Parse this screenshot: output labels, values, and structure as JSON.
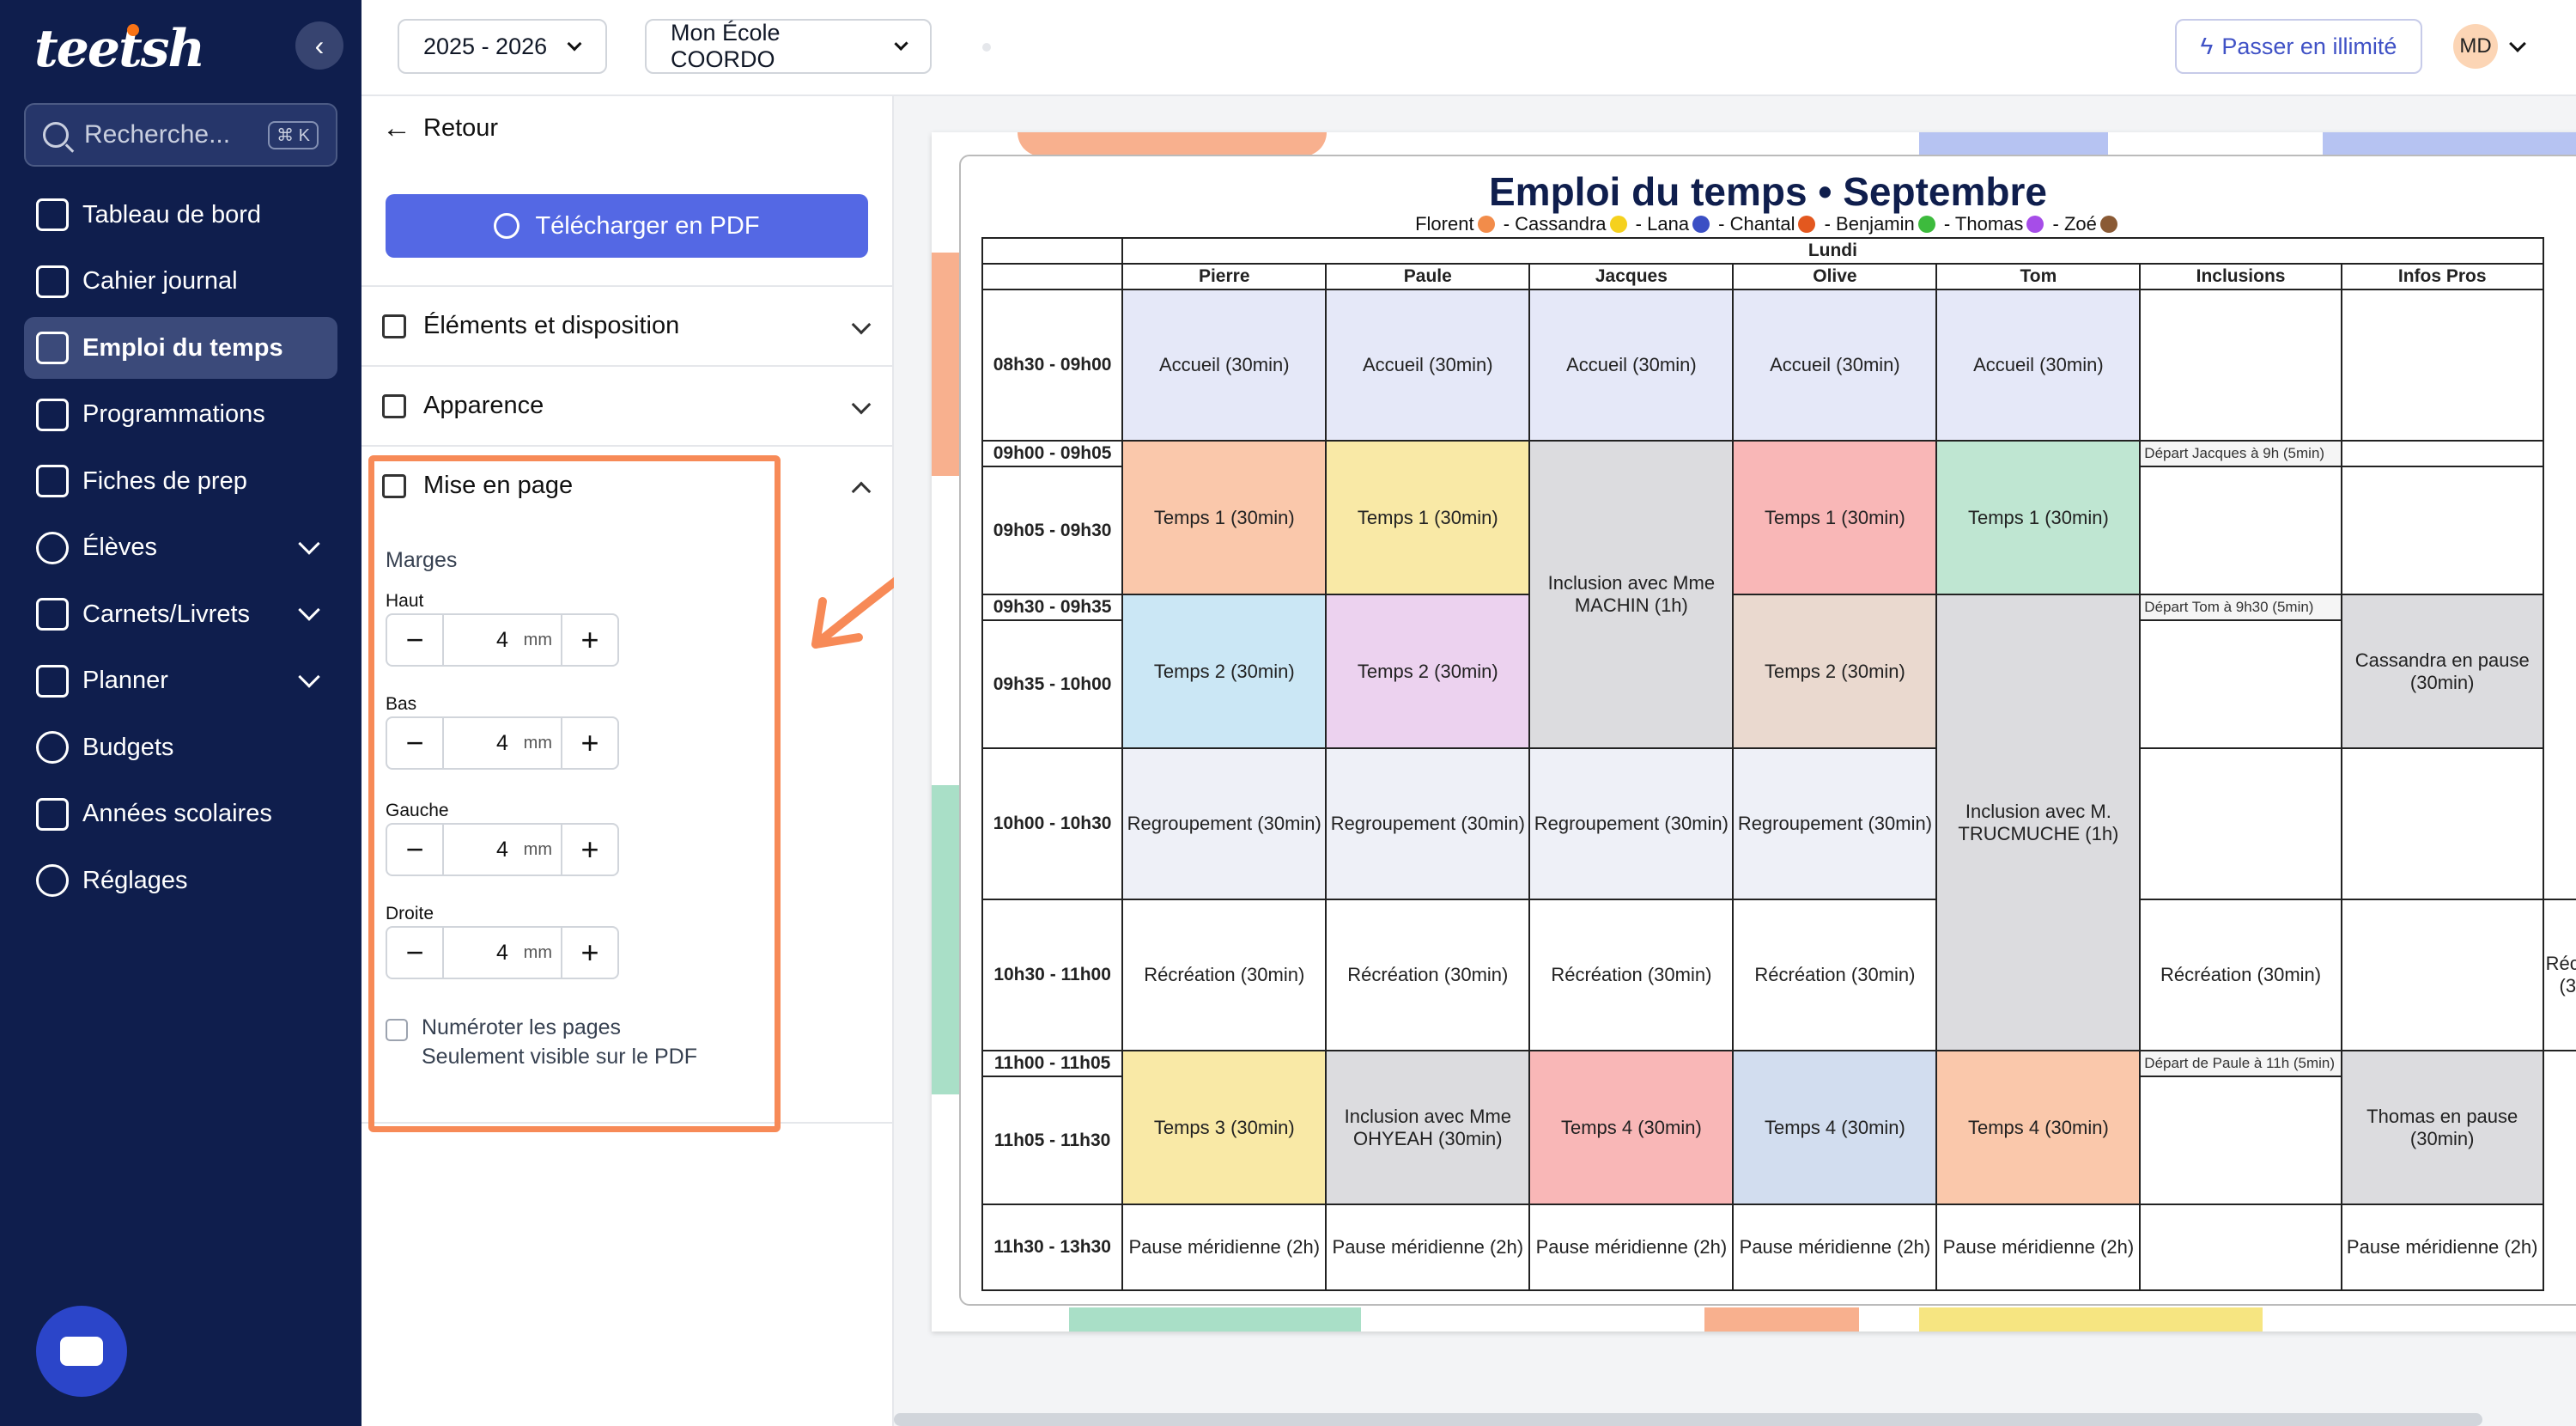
{
  "app": {
    "logo": "teetsh"
  },
  "sidebar": {
    "search_placeholder": "Recherche...",
    "search_shortcut": "⌘ K",
    "items": [
      {
        "label": "Tableau de bord",
        "icon": "dashboard-icon"
      },
      {
        "label": "Cahier journal",
        "icon": "book-icon"
      },
      {
        "label": "Emploi du temps",
        "icon": "calendar-icon",
        "active": true
      },
      {
        "label": "Programmations",
        "icon": "list-icon"
      },
      {
        "label": "Fiches de prep",
        "icon": "document-icon"
      },
      {
        "label": "Élèves",
        "icon": "students-icon",
        "expandable": true
      },
      {
        "label": "Carnets/Livrets",
        "icon": "notebook-icon",
        "expandable": true
      },
      {
        "label": "Planner",
        "icon": "planner-icon",
        "expandable": true
      },
      {
        "label": "Budgets",
        "icon": "piggy-bank-icon"
      },
      {
        "label": "Années scolaires",
        "icon": "school-icon"
      },
      {
        "label": "Réglages",
        "icon": "gear-icon"
      }
    ]
  },
  "topbar": {
    "year": "2025 - 2026",
    "school": "Mon École COORDO",
    "upgrade_label": "Passer en illimité",
    "avatar_initials": "MD"
  },
  "panel": {
    "back_label": "Retour",
    "pdf_button": "Télécharger en PDF",
    "sections": {
      "elements": "Éléments et disposition",
      "appearance": "Apparence",
      "layout": "Mise en page"
    },
    "margins_title": "Marges",
    "margins": [
      {
        "label": "Haut",
        "value": "4",
        "unit": "mm"
      },
      {
        "label": "Bas",
        "value": "4",
        "unit": "mm"
      },
      {
        "label": "Gauche",
        "value": "4",
        "unit": "mm"
      },
      {
        "label": "Droite",
        "value": "4",
        "unit": "mm"
      }
    ],
    "number_pages_label": "Numéroter les pages",
    "number_pages_sub": "Seulement visible sur le PDF"
  },
  "schedule": {
    "title": "Emploi du temps • Septembre",
    "students": [
      {
        "name": "Florent",
        "color": "#f28c4a"
      },
      {
        "name": "Cassandra",
        "color": "#f5d11e"
      },
      {
        "name": "Lana",
        "color": "#3b4fc4"
      },
      {
        "name": "Chantal",
        "color": "#e3581f"
      },
      {
        "name": "Benjamin",
        "color": "#3dbb3d"
      },
      {
        "name": "Thomas",
        "color": "#a64de8"
      },
      {
        "name": "Zoé",
        "color": "#8a5a35"
      }
    ],
    "day": "Lundi",
    "columns": [
      "Pierre",
      "Paule",
      "Jacques",
      "Olive",
      "Tom",
      "Inclusions",
      "Infos Pros"
    ],
    "times": {
      "t1": "08h30 - 09h00",
      "t2": "09h00 - 09h05",
      "t3": "09h05 - 09h30",
      "t4": "09h30 - 09h35",
      "t5": "09h35 - 10h00",
      "t6": "10h00 - 10h30",
      "t7": "10h30 - 11h00",
      "t8": "11h00 - 11h05",
      "t9": "11h05 - 11h30",
      "t10": "11h30 - 13h30"
    },
    "cells": {
      "accueil": "Accueil (30min)",
      "temps1": "Temps 1 (30min)",
      "temps2": "Temps 2 (30min)",
      "temps3": "Temps 3 (30min)",
      "temps4": "Temps 4 (30min)",
      "regroupement": "Regroupement (30min)",
      "recreation": "Récréation (30min)",
      "pause": "Pause méridienne (2h)",
      "inclusion_machin": "Inclusion avec Mme MACHIN (1h)",
      "inclusion_trucmuche": "Inclusion avec M. TRUCMUCHE (1h)",
      "inclusion_ohyeah": "Inclusion avec Mme OHYEAH (30min)",
      "depart_jacques": "Départ Jacques à 9h (5min)",
      "depart_tom": "Départ Tom à 9h30 (5min)",
      "depart_paule": "Départ de Paule à 11h (5min)",
      "cassandra_pause": "Cassandra en pause (30min)",
      "thomas_pause": "Thomas en pause (30min)"
    }
  },
  "colors": {
    "sidebar_bg": "#0f1e4d",
    "accent": "#5468e4",
    "highlight": "#f78a57"
  }
}
